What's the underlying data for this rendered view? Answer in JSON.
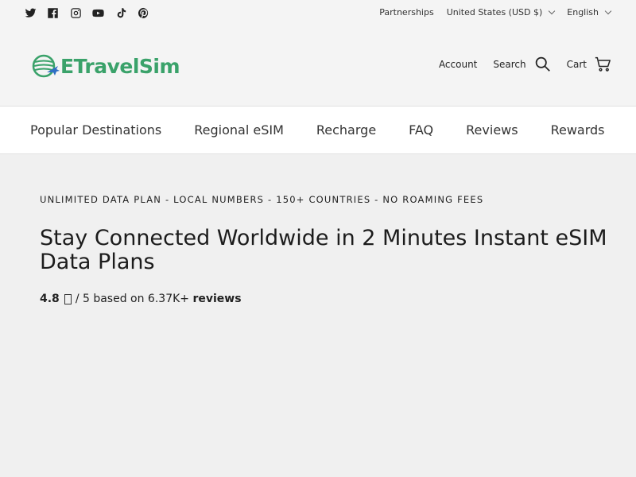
{
  "topbar": {
    "social_icons": [
      "twitter-icon",
      "facebook-icon",
      "instagram-icon",
      "youtube-icon",
      "tiktok-icon",
      "pinterest-icon"
    ],
    "partnerships": "Partnerships",
    "currency": "United States (USD $)",
    "language": "English"
  },
  "header": {
    "logo_text": "ETravelSim",
    "account": "Account",
    "search": "Search",
    "cart": "Cart"
  },
  "nav": {
    "items": [
      "Popular Destinations",
      "Regional eSIM",
      "Recharge",
      "FAQ",
      "Reviews",
      "Rewards"
    ]
  },
  "hero": {
    "eyebrow": "UNLIMITED DATA PLAN - LOCAL NUMBERS - 150+ COUNTRIES - NO ROAMING FEES",
    "title": "Stay Connected Worldwide in 2 Minutes Instant eSIM Data Plans",
    "rating_value": "4.8",
    "rating_scale": "/ 5 based on 6.37K+",
    "rating_reviews": "reviews"
  },
  "colors": {
    "brand": "#3aa26a",
    "page_bg": "#f0f0f0",
    "nav_bg": "#ffffff"
  }
}
